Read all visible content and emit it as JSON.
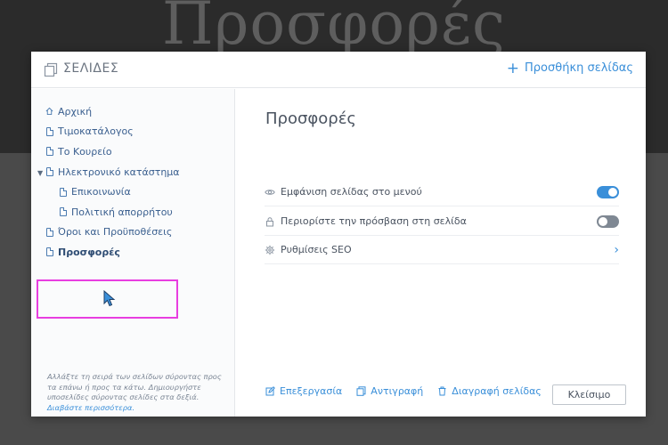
{
  "background": {
    "hero_title": "Προσφορές"
  },
  "modal": {
    "title": "ΣΕΛΙΔΕΣ",
    "add_page_label": "Προσθήκη σελίδας",
    "pages": [
      {
        "label": "Αρχική",
        "icon": "home-icon",
        "level": 0
      },
      {
        "label": "Τιμοκατάλογος",
        "icon": "page-icon",
        "level": 0
      },
      {
        "label": "Το Κουρείο",
        "icon": "page-icon",
        "level": 0
      },
      {
        "label": "Ηλεκτρονικό κατάστημα",
        "icon": "page-icon",
        "level": 0,
        "expanded": true
      },
      {
        "label": "Επικοινωνία",
        "icon": "page-icon",
        "level": 1
      },
      {
        "label": "Πολιτική απορρήτου",
        "icon": "page-icon",
        "level": 1
      },
      {
        "label": "Όροι και Προϋποθέσεις",
        "icon": "page-icon",
        "level": 0
      },
      {
        "label": "Προσφορές",
        "icon": "page-icon",
        "level": 0,
        "selected": true
      }
    ],
    "help_text": "Αλλάξτε τη σειρά των σελίδων σύροντας προς τα επάνω ή προς τα κάτω. Δημιουργήστε υποσελίδες σύροντας σελίδες στα δεξιά.",
    "help_link": "Διαβάστε περισσότερα.",
    "detail": {
      "title": "Προσφορές",
      "settings": [
        {
          "label": "Εμφάνιση σελίδας στο μενού",
          "icon": "eye-icon",
          "control": "toggle",
          "value": true
        },
        {
          "label": "Περιορίστε την πρόσβαση στη σελίδα",
          "icon": "lock-icon",
          "control": "toggle",
          "value": false
        },
        {
          "label": "Ρυθμίσεις SEO",
          "icon": "gear-icon",
          "control": "chevron"
        }
      ],
      "actions": {
        "edit": "Επεξεργασία",
        "duplicate": "Αντιγραφή",
        "delete": "Διαγραφή σελίδας"
      },
      "close_label": "Κλείσιμο"
    }
  },
  "colors": {
    "accent": "#3a8fd9",
    "highlight": "#e83ee0",
    "toggle_off": "#7f8893"
  }
}
